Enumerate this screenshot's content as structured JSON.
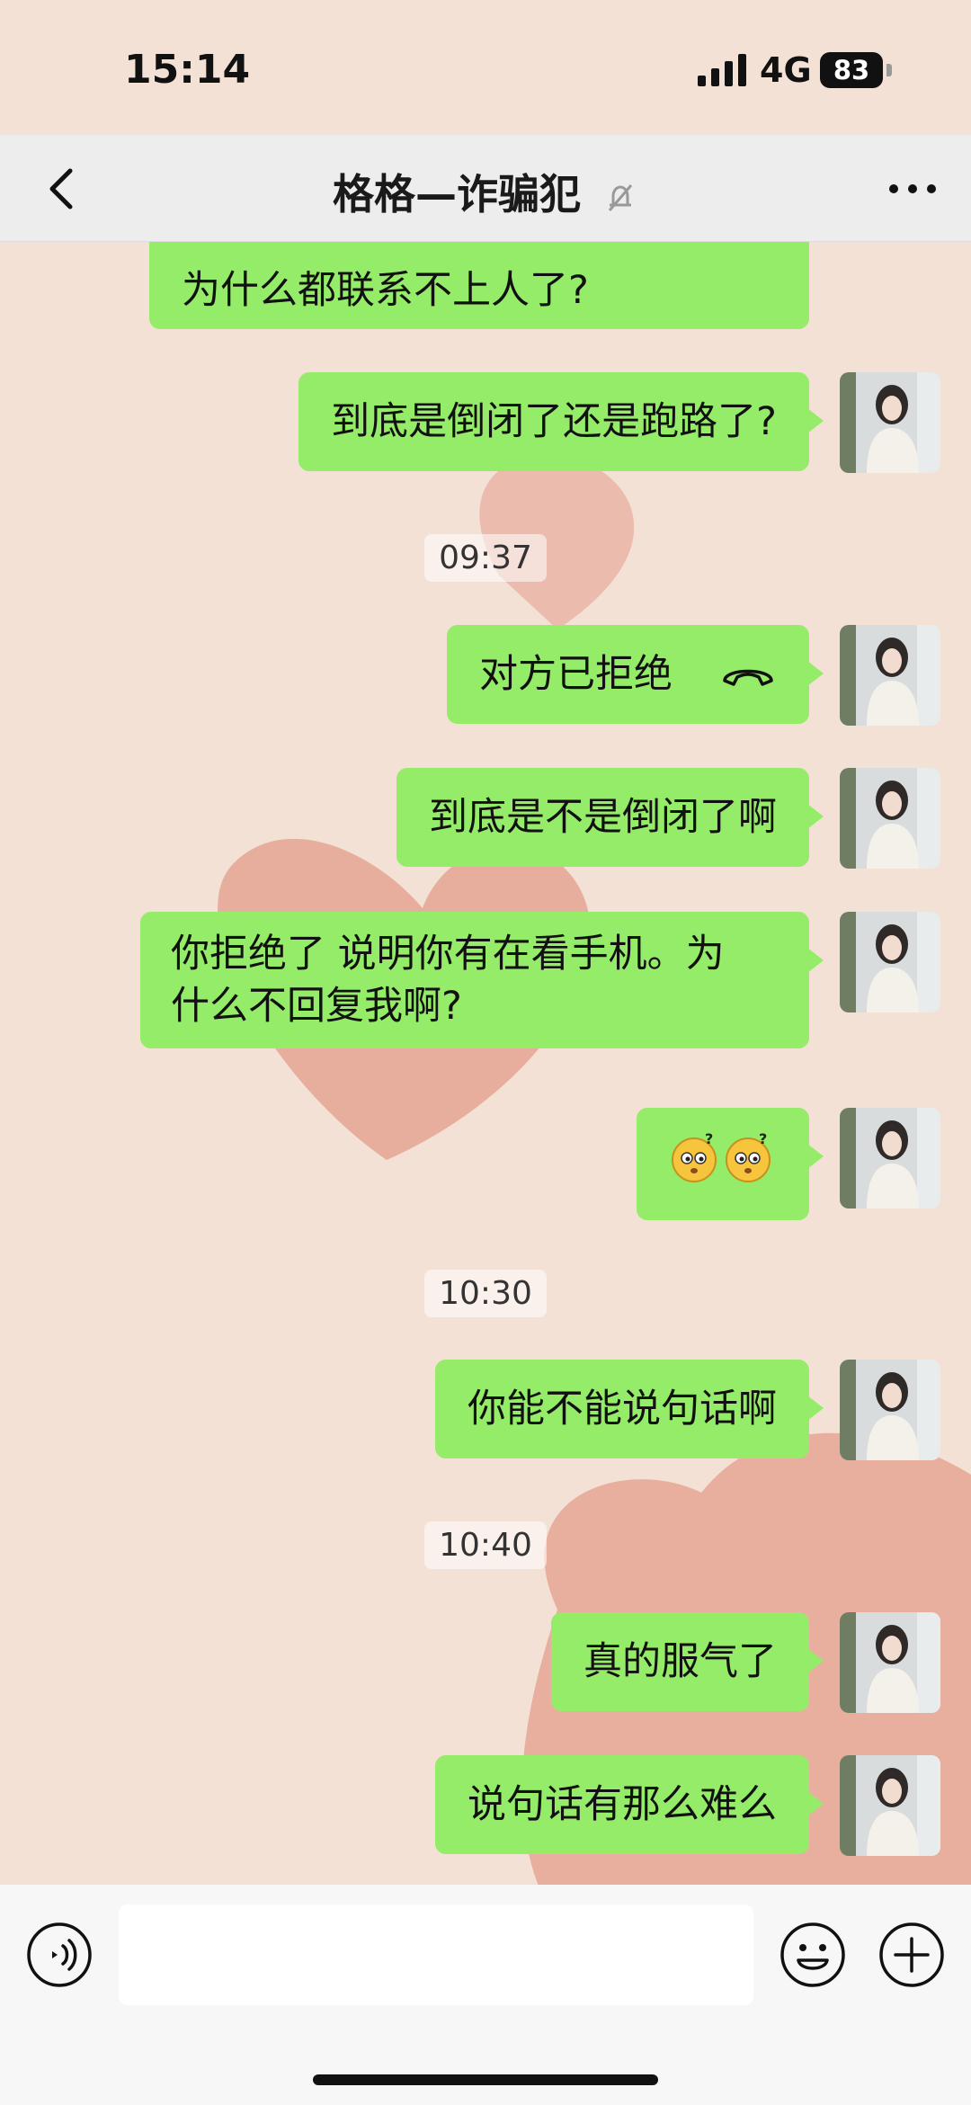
{
  "status_bar": {
    "time": "15:14",
    "network": "4G",
    "battery": "83"
  },
  "nav": {
    "title": "格格—诈骗犯",
    "back_icon": "chevron-left-icon",
    "mute_icon": "bell-off-icon",
    "more_icon": "more-dots-icon"
  },
  "messages": [
    {
      "text": "为什么都联系不上人了?"
    },
    {
      "text": "到底是倒闭了还是跑路了?"
    },
    {
      "time": "09:37"
    },
    {
      "text": "对方已拒绝",
      "icon": "hangup-icon"
    },
    {
      "text": "到底是不是倒闭了啊"
    },
    {
      "line1": "你拒绝了 说明你有在看手机。为",
      "line2": "什么不回复我啊?"
    },
    {
      "emoji": "confused-face-emoji"
    },
    {
      "time": "10:30"
    },
    {
      "text": "你能不能说句话啊"
    },
    {
      "time": "10:40"
    },
    {
      "text": "真的服气了"
    },
    {
      "text": "说句话有那么难么"
    }
  ],
  "input_bar": {
    "voice_icon": "voice-icon",
    "emoji_icon": "emoji-icon",
    "plus_icon": "plus-icon"
  },
  "colors": {
    "bubble": "#95ec69",
    "navbar": "#ededed",
    "background": "#f3e1d6",
    "heart": "#e4a08f"
  }
}
